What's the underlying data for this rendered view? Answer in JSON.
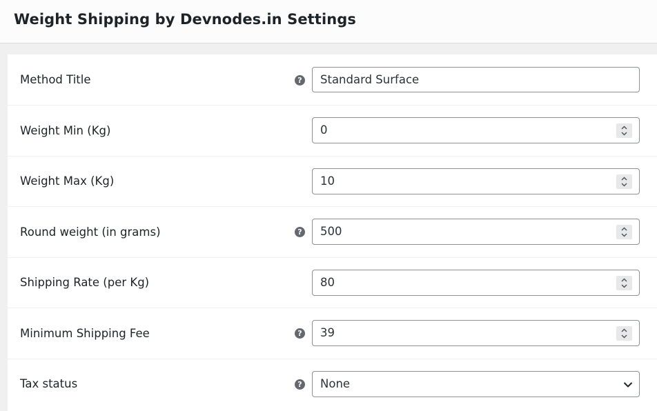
{
  "header": {
    "title": "Weight Shipping by Devnodes.in Settings"
  },
  "fields": [
    {
      "label": "Method Title",
      "value": "Standard Surface",
      "type": "text",
      "help": true
    },
    {
      "label": "Weight Min (Kg)",
      "value": "0",
      "type": "number",
      "help": false
    },
    {
      "label": "Weight Max (Kg)",
      "value": "10",
      "type": "number",
      "help": false
    },
    {
      "label": "Round weight (in grams)",
      "value": "500",
      "type": "number",
      "help": true
    },
    {
      "label": "Shipping Rate (per Kg)",
      "value": "80",
      "type": "number",
      "help": false
    },
    {
      "label": "Minimum Shipping Fee",
      "value": "39",
      "type": "number",
      "help": true
    },
    {
      "label": "Tax status",
      "value": "None",
      "type": "select",
      "help": true
    }
  ],
  "icons": {
    "help": "question-mark-help-icon",
    "spinner": "number-stepper-icon",
    "dropdown": "chevron-down-icon"
  },
  "help_glyph": "?",
  "colors": {
    "help_icon": "#646970",
    "border": "#8c8f94",
    "background": "#f0f0f1"
  }
}
